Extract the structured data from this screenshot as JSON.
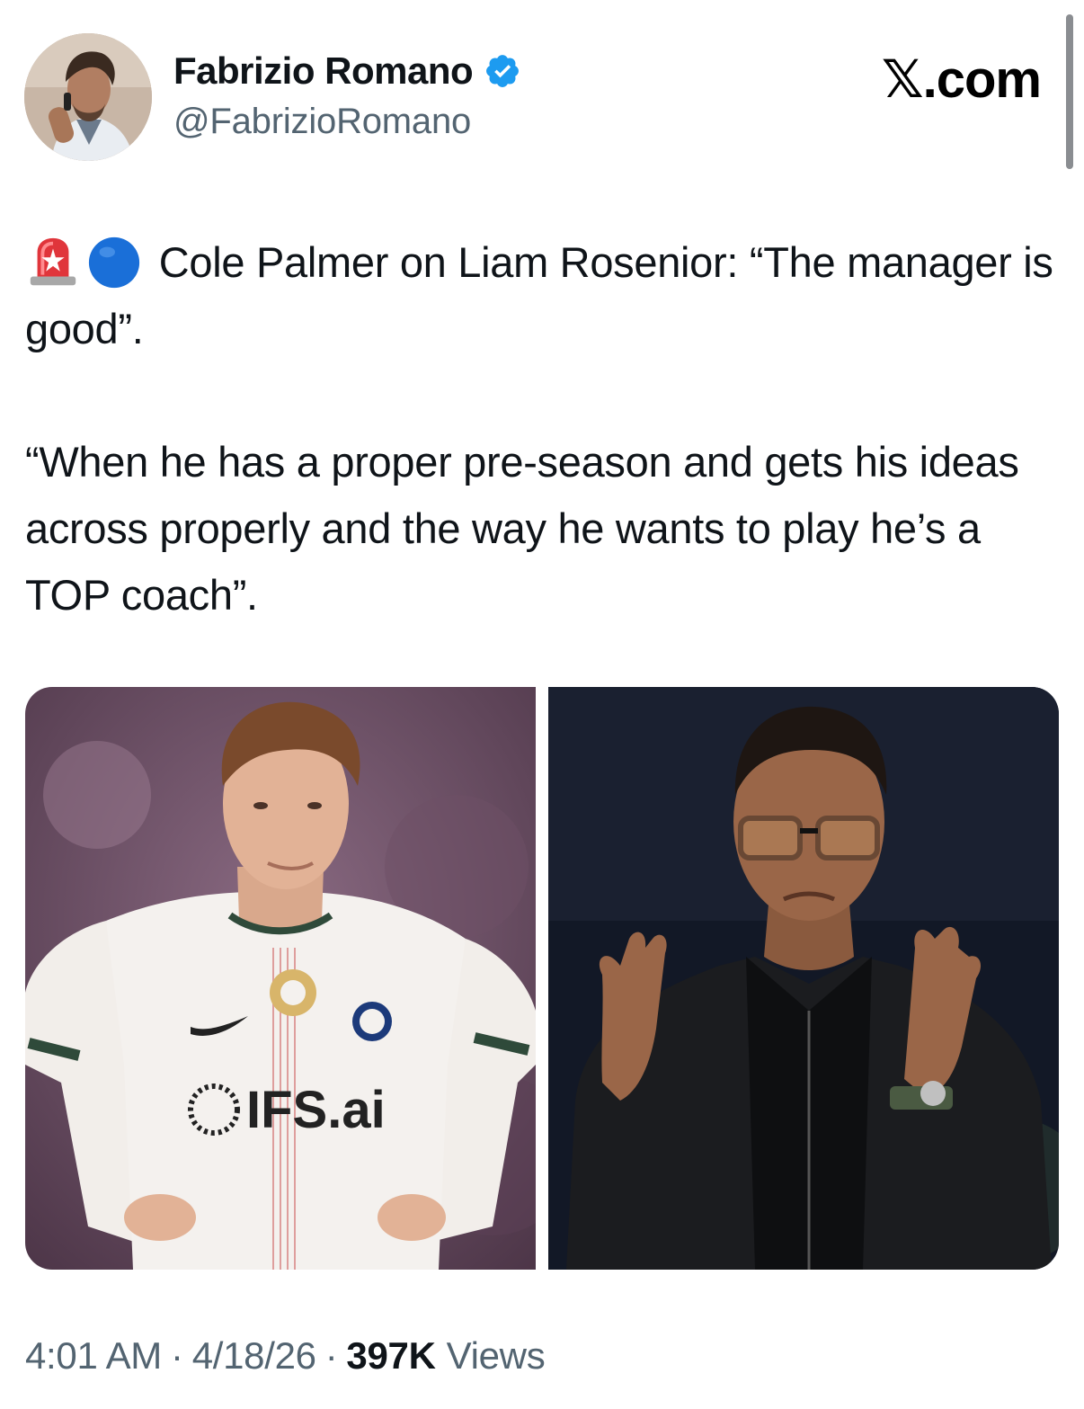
{
  "author": {
    "display_name": "Fabrizio Romano",
    "handle": "@FabrizioRomano",
    "verified": true,
    "avatar_icon": "profile-photo"
  },
  "brand": {
    "x_letter": "𝕏",
    "domain": ".com"
  },
  "tweet": {
    "emojis": [
      "rotating-light-emoji",
      "blue-circle-emoji"
    ],
    "line1": "Cole Palmer on Liam Rosenior: “The manager is good”.",
    "line2": "“When he has a proper pre-season and gets his ideas across properly and the way he wants to play he’s a TOP coach”."
  },
  "media": {
    "photo_left": {
      "sponsor_text": "IFS.ai"
    },
    "photo_right": {}
  },
  "meta": {
    "time": "4:01 AM",
    "separator": "·",
    "date": "4/18/26",
    "views_count": "397K",
    "views_label": "Views"
  },
  "colors": {
    "verified_blue": "#1d9bf0",
    "text_primary": "#0f1419",
    "text_secondary": "#536471"
  }
}
